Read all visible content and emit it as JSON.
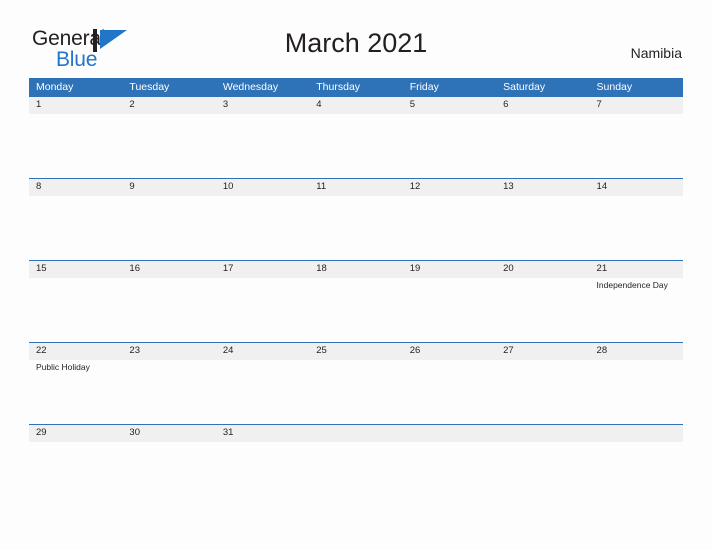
{
  "brand": {
    "name_part1": "General",
    "name_part2": "Blue",
    "mark_icon": "triangle-flag-icon",
    "color_dark": "#231f20",
    "color_blue": "#2176c7"
  },
  "header": {
    "title": "March 2021",
    "locale": "Namibia"
  },
  "calendar": {
    "accent_color": "#2e72b8",
    "date_band_color": "#f0f0f0",
    "body_color": "#fdfdfd",
    "weekdays": [
      "Monday",
      "Tuesday",
      "Wednesday",
      "Thursday",
      "Friday",
      "Saturday",
      "Sunday"
    ],
    "weeks": [
      {
        "days": [
          {
            "num": "1",
            "event": ""
          },
          {
            "num": "2",
            "event": ""
          },
          {
            "num": "3",
            "event": ""
          },
          {
            "num": "4",
            "event": ""
          },
          {
            "num": "5",
            "event": ""
          },
          {
            "num": "6",
            "event": ""
          },
          {
            "num": "7",
            "event": ""
          }
        ]
      },
      {
        "days": [
          {
            "num": "8",
            "event": ""
          },
          {
            "num": "9",
            "event": ""
          },
          {
            "num": "10",
            "event": ""
          },
          {
            "num": "11",
            "event": ""
          },
          {
            "num": "12",
            "event": ""
          },
          {
            "num": "13",
            "event": ""
          },
          {
            "num": "14",
            "event": ""
          }
        ]
      },
      {
        "days": [
          {
            "num": "15",
            "event": ""
          },
          {
            "num": "16",
            "event": ""
          },
          {
            "num": "17",
            "event": ""
          },
          {
            "num": "18",
            "event": ""
          },
          {
            "num": "19",
            "event": ""
          },
          {
            "num": "20",
            "event": ""
          },
          {
            "num": "21",
            "event": "Independence Day"
          }
        ]
      },
      {
        "days": [
          {
            "num": "22",
            "event": "Public Holiday"
          },
          {
            "num": "23",
            "event": ""
          },
          {
            "num": "24",
            "event": ""
          },
          {
            "num": "25",
            "event": ""
          },
          {
            "num": "26",
            "event": ""
          },
          {
            "num": "27",
            "event": ""
          },
          {
            "num": "28",
            "event": ""
          }
        ]
      },
      {
        "last": true,
        "days": [
          {
            "num": "29",
            "event": ""
          },
          {
            "num": "30",
            "event": ""
          },
          {
            "num": "31",
            "event": ""
          },
          {
            "num": "",
            "event": ""
          },
          {
            "num": "",
            "event": ""
          },
          {
            "num": "",
            "event": ""
          },
          {
            "num": "",
            "event": ""
          }
        ]
      }
    ]
  }
}
